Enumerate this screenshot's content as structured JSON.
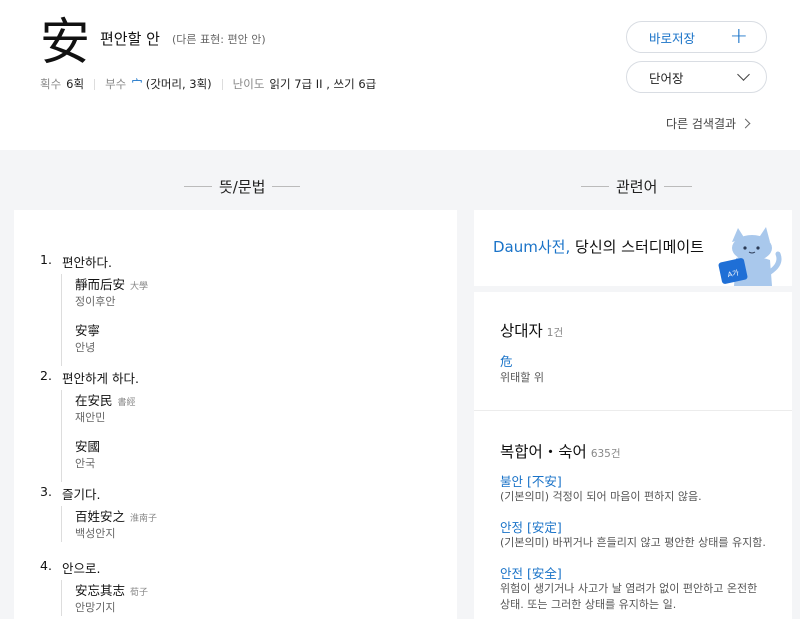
{
  "header": {
    "hanja": "安",
    "meaning": "편안할 안",
    "alt_expression": "(다른 표현: 편안 안)",
    "stroke_label": "획수",
    "stroke_value": "6획",
    "radical_label": "부수",
    "radical_char": "宀",
    "radical_desc": "(갓머리, 3획)",
    "level_label": "난이도",
    "level_value": "읽기 7급 II , 쓰기 6급",
    "save_button": "바로저장",
    "vocab_button": "단어장",
    "other_results": "다른 검색결과"
  },
  "sections": {
    "left_title": "뜻/문법",
    "right_title": "관련어"
  },
  "meanings": [
    {
      "num": "1.",
      "text": "편안하다.",
      "examples": [
        {
          "hanja": "靜而后安",
          "source": "大學",
          "reading": "정이후안"
        },
        {
          "hanja": "安寧",
          "source": "",
          "reading": "안녕"
        }
      ]
    },
    {
      "num": "2.",
      "text": "편안하게 하다.",
      "examples": [
        {
          "hanja": "在安民",
          "source": "書經",
          "reading": "재안민"
        },
        {
          "hanja": "安國",
          "source": "",
          "reading": "안국"
        }
      ]
    },
    {
      "num": "3.",
      "text": "즐기다.",
      "examples": [
        {
          "hanja": "百姓安之",
          "source": "淮南子",
          "reading": "백성안지"
        }
      ]
    },
    {
      "num": "4.",
      "text": "안으로.",
      "examples": [
        {
          "hanja": "安忘其志",
          "source": "荀子",
          "reading": "안망기지"
        }
      ]
    }
  ],
  "promo": {
    "brand": "Daum사전,",
    "tagline": "당신의 스터디메이트"
  },
  "antonyms": {
    "title": "상대자",
    "count": "1건",
    "items": [
      {
        "word": "危",
        "def": "위태할 위"
      }
    ]
  },
  "compounds": {
    "title": "복합어・숙어",
    "count": "635건",
    "items": [
      {
        "word": "불안 [不安]",
        "def": "(기본의미) 걱정이 되어 마음이 편하지 않음."
      },
      {
        "word": "안정 [安定]",
        "def": "(기본의미) 바뀌거나 흔들리지 않고 평안한 상태를 유지함."
      },
      {
        "word": "안전 [安全]",
        "def": "위험이 생기거나 사고가 날 염려가 없이 편안하고 온전한 상태. 또는 그러한 상태를 유지하는 일."
      }
    ]
  },
  "colors": {
    "accent": "#1a73c8",
    "background": "#f4f5f7"
  }
}
